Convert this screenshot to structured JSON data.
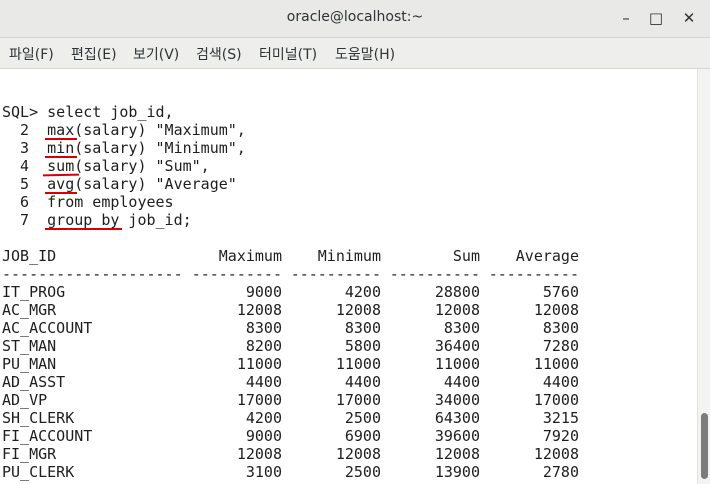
{
  "window": {
    "title": "oracle@localhost:~",
    "minimize": "–",
    "maximize": "□",
    "close": "✕"
  },
  "menu": [
    "파일(F)",
    "편집(E)",
    "보기(V)",
    "검색(S)",
    "터미널(T)",
    "도움말(H)"
  ],
  "query": {
    "lines": [
      "SQL> select job_id,",
      "  2  max(salary) \"Maximum\",",
      "  3  min(salary) \"Minimum\",",
      "  4  sum(salary) \"Sum\",",
      "  5  avg(salary) \"Average\"",
      "  6  from employees",
      "  7  group by job_id;"
    ]
  },
  "results": {
    "headers": [
      "JOB_ID",
      "Maximum",
      "Minimum",
      "Sum",
      "Average"
    ],
    "separators": [
      "--------------------",
      "----------",
      "----------",
      "----------",
      "----------"
    ],
    "rows": [
      [
        "IT_PROG",
        "9000",
        "4200",
        "28800",
        "5760"
      ],
      [
        "AC_MGR",
        "12008",
        "12008",
        "12008",
        "12008"
      ],
      [
        "AC_ACCOUNT",
        "8300",
        "8300",
        "8300",
        "8300"
      ],
      [
        "ST_MAN",
        "8200",
        "5800",
        "36400",
        "7280"
      ],
      [
        "PU_MAN",
        "11000",
        "11000",
        "11000",
        "11000"
      ],
      [
        "AD_ASST",
        "4400",
        "4400",
        "4400",
        "4400"
      ],
      [
        "AD_VP",
        "17000",
        "17000",
        "34000",
        "17000"
      ],
      [
        "SH_CLERK",
        "4200",
        "2500",
        "64300",
        "3215"
      ],
      [
        "FI_ACCOUNT",
        "9000",
        "6900",
        "39600",
        "7920"
      ],
      [
        "FI_MGR",
        "12008",
        "12008",
        "12008",
        "12008"
      ],
      [
        "PU_CLERK",
        "3100",
        "2500",
        "13900",
        "2780"
      ]
    ]
  },
  "colors": {
    "underline": "#d80000",
    "text": "#1e1e1e",
    "titlebar": "#e9e9e7"
  }
}
